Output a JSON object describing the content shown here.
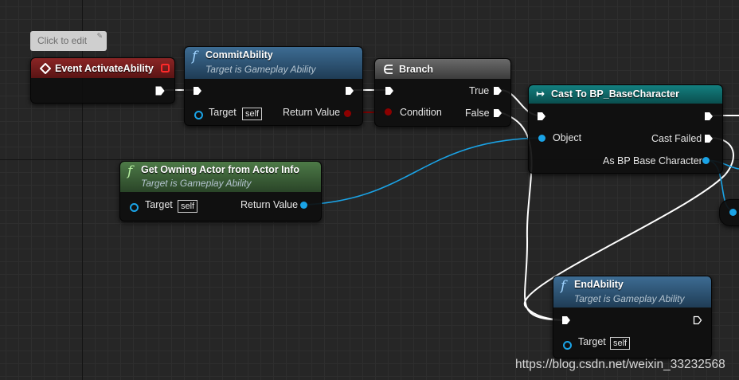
{
  "comment_bubble": {
    "text": "Click to edit"
  },
  "nodes": {
    "event": {
      "title": "Event ActivateAbility",
      "color": "#7a1e1e"
    },
    "commit": {
      "title": "CommitAbility",
      "subtitle": "Target is Gameplay Ability",
      "target_label": "Target",
      "self_label": "self",
      "return_label": "Return Value"
    },
    "branch": {
      "title": "Branch",
      "true_label": "True",
      "false_label": "False",
      "condition_label": "Condition"
    },
    "cast": {
      "title": "Cast To BP_BaseCharacter",
      "object_label": "Object",
      "cast_failed_label": "Cast Failed",
      "as_label": "As BP Base Character"
    },
    "owning": {
      "title": "Get Owning Actor from Actor Info",
      "subtitle": "Target is Gameplay Ability",
      "target_label": "Target",
      "self_label": "self",
      "return_label": "Return Value"
    },
    "end": {
      "title": "EndAbility",
      "subtitle": "Target is Gameplay Ability",
      "target_label": "Target",
      "self_label": "self"
    }
  },
  "colors": {
    "exec_wire": "#ffffff",
    "object_wire": "#1aa3e6",
    "bool_pin": "#8c0000",
    "function_header": "#2f5a80",
    "pure_function_header": "#3d6a3a",
    "cast_header": "#0f6c6c",
    "branch_header": "#555555"
  },
  "watermark": "https://blog.csdn.net/weixin_33232568"
}
